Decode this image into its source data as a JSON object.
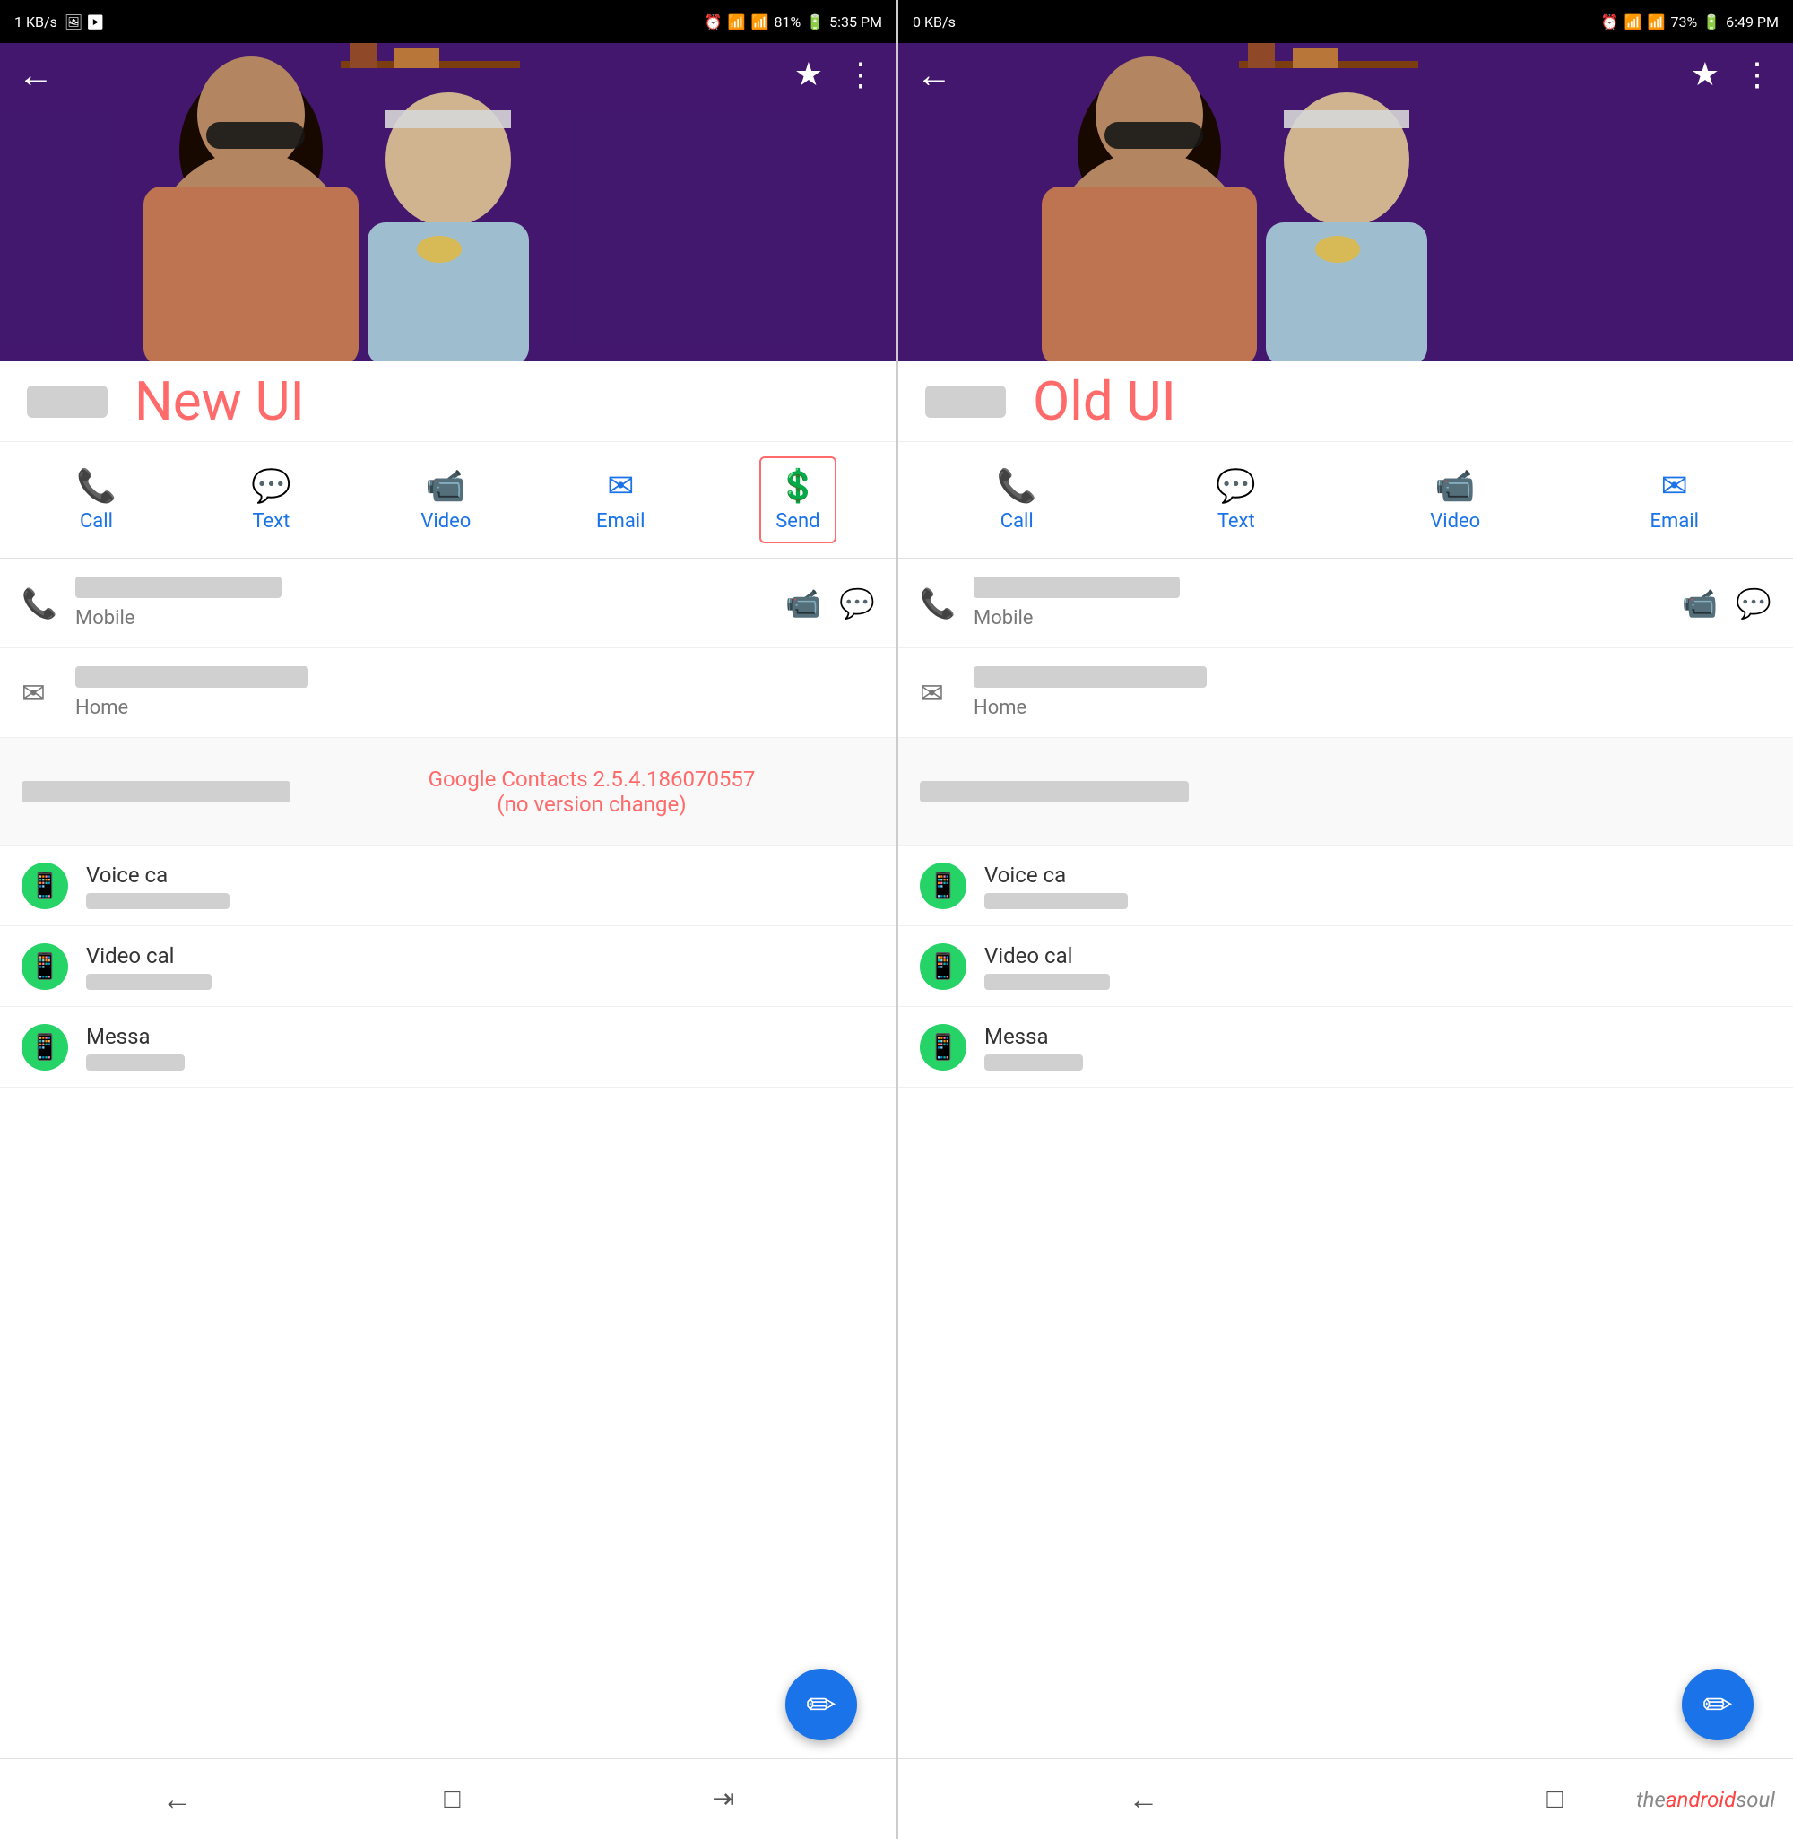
{
  "left_panel": {
    "status_bar": {
      "speed": "1 KB/s",
      "battery": "81%",
      "time": "5:35 PM"
    },
    "ui_label": "New UI",
    "action_buttons": [
      {
        "id": "call",
        "icon": "📞",
        "label": "Call"
      },
      {
        "id": "text",
        "icon": "💬",
        "label": "Text"
      },
      {
        "id": "video",
        "icon": "📹",
        "label": "Video"
      },
      {
        "id": "email",
        "icon": "✉",
        "label": "Email"
      },
      {
        "id": "send",
        "icon": "$",
        "label": "Send",
        "highlighted": true
      }
    ],
    "contact_details": {
      "phone_label": "Mobile",
      "email_label": "Home"
    },
    "whatsapp_items": [
      {
        "label": "Voice ca"
      },
      {
        "label": "Video cal"
      },
      {
        "label": "Messa"
      }
    ]
  },
  "right_panel": {
    "status_bar": {
      "speed": "0 KB/s",
      "battery": "73%",
      "time": "6:49 PM"
    },
    "ui_label": "Old UI",
    "action_buttons": [
      {
        "id": "call",
        "icon": "📞",
        "label": "Call"
      },
      {
        "id": "text",
        "icon": "💬",
        "label": "Text"
      },
      {
        "id": "video",
        "icon": "📹",
        "label": "Video"
      },
      {
        "id": "email",
        "icon": "✉",
        "label": "Email"
      }
    ],
    "contact_details": {
      "phone_label": "Mobile",
      "email_label": "Home"
    },
    "whatsapp_items": [
      {
        "label": "Voice ca"
      },
      {
        "label": "Video cal"
      },
      {
        "label": "Messa"
      }
    ]
  },
  "version_info": {
    "line1": "Google Contacts 2.5.4.186070557",
    "line2": "(no version change)"
  },
  "attribution": {
    "prefix": "the",
    "brand": "android",
    "suffix": "soul"
  },
  "nav_buttons": {
    "back": "←",
    "overview": "□",
    "recent": "⇥"
  }
}
